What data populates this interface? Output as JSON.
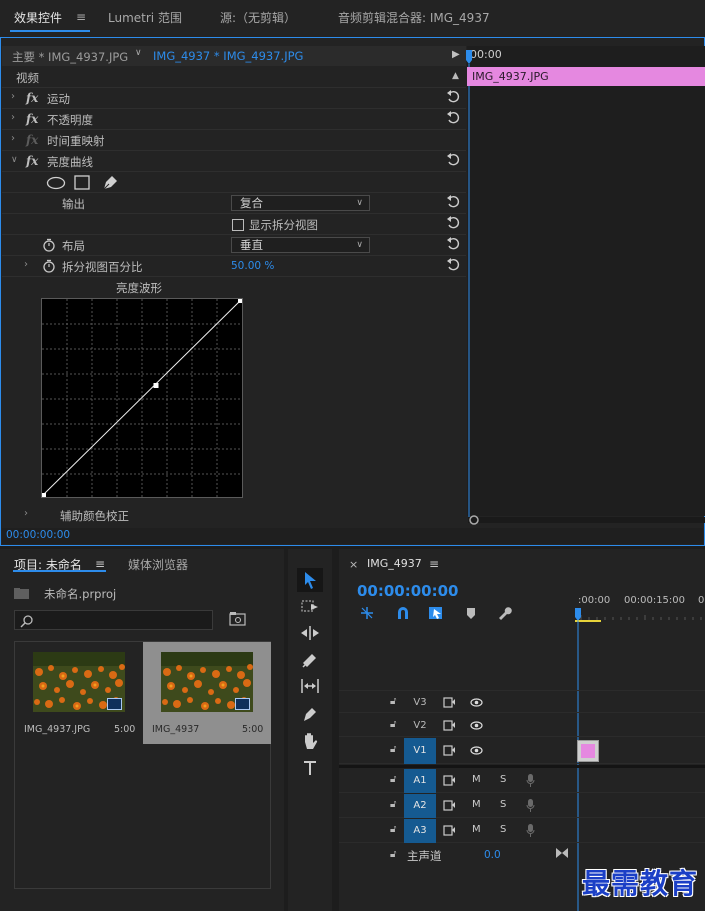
{
  "top_tabs": {
    "effect_controls": "效果控件",
    "lumetri": "Lumetri 范围",
    "source": "源:（无剪辑）",
    "audio_mixer": "音频剪辑混合器: IMG_4937"
  },
  "effect_controls": {
    "master_clip": "主要 * IMG_4937.JPG",
    "sequence_clip": "IMG_4937 * IMG_4937.JPG",
    "timecode_start": "00:00",
    "clip_label": "IMG_4937.JPG",
    "video_header": "视频",
    "effects": [
      "运动",
      "不透明度",
      "时间重映射",
      "亮度曲线"
    ],
    "output_label": "输出",
    "output_value": "复合",
    "show_split_label": "显示拆分视图",
    "layout_label": "布局",
    "layout_value": "垂直",
    "split_percent_label": "拆分视图百分比",
    "split_percent_value": "50.00 %",
    "waveform_title": "亮度波形",
    "secondary_label": "辅助颜色校正",
    "footer_timecode": "00:00:00:00"
  },
  "project": {
    "title": "项目: 未命名",
    "media_browser": "媒体浏览器",
    "file": "未命名.prproj",
    "items": [
      {
        "name": "IMG_4937.JPG",
        "duration": "5:00"
      },
      {
        "name": "IMG_4937",
        "duration": "5:00"
      }
    ]
  },
  "sequence": {
    "name": "IMG_4937",
    "timecode": "00:00:00:00",
    "ruler": [
      ":00:00",
      "00:00:15:00",
      "0"
    ],
    "video_tracks": [
      "V3",
      "V2",
      "V1"
    ],
    "audio_tracks": [
      "A1",
      "A2",
      "A3"
    ],
    "mute": "M",
    "solo": "S",
    "master_label": "主声道",
    "master_value": "0.0"
  },
  "watermark": "最需教育",
  "colors": {
    "accent": "#2d8ceb",
    "clip": "#e588e0",
    "track_selected": "#155a91"
  }
}
